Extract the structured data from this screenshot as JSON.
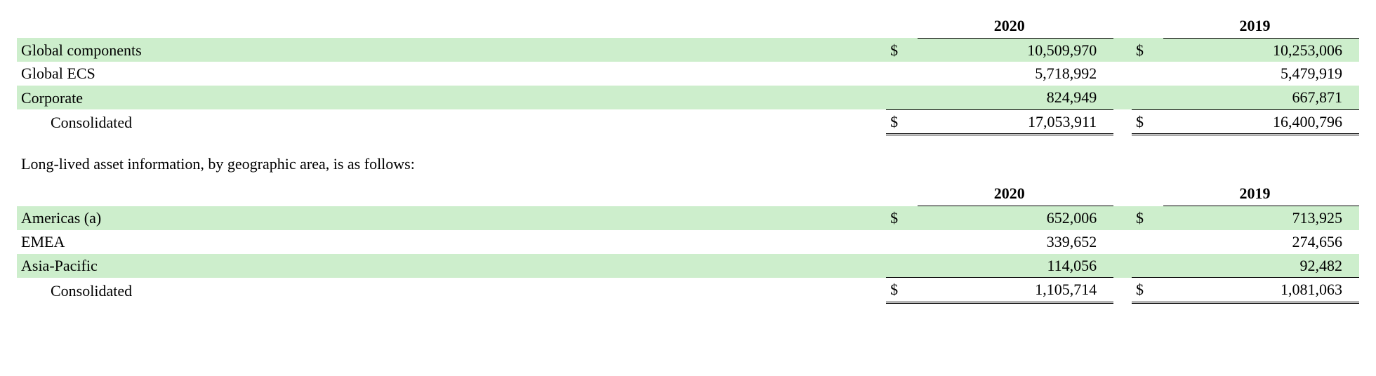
{
  "segments_table": {
    "headers": {
      "y1": "2020",
      "y2": "2019"
    },
    "rows": [
      {
        "label": "Global components",
        "sym1": "$",
        "v1": "10,509,970",
        "sym2": "$",
        "v2": "10,253,006"
      },
      {
        "label": "Global ECS",
        "sym1": "",
        "v1": "5,718,992",
        "sym2": "",
        "v2": "5,479,919"
      },
      {
        "label": "Corporate",
        "sym1": "",
        "v1": "824,949",
        "sym2": "",
        "v2": "667,871"
      }
    ],
    "total": {
      "label": "Consolidated",
      "sym1": "$",
      "v1": "17,053,911",
      "sym2": "$",
      "v2": "16,400,796"
    }
  },
  "intertext": "Long-lived asset information, by geographic area, is as follows:",
  "geo_table": {
    "headers": {
      "y1": "2020",
      "y2": "2019"
    },
    "rows": [
      {
        "label": "Americas (a)",
        "sym1": "$",
        "v1": "652,006",
        "sym2": "$",
        "v2": "713,925"
      },
      {
        "label": "EMEA",
        "sym1": "",
        "v1": "339,652",
        "sym2": "",
        "v2": "274,656"
      },
      {
        "label": "Asia-Pacific",
        "sym1": "",
        "v1": "114,056",
        "sym2": "",
        "v2": "92,482"
      }
    ],
    "total": {
      "label": "Consolidated",
      "sym1": "$",
      "v1": "1,105,714",
      "sym2": "$",
      "v2": "1,081,063"
    }
  },
  "chart_data": [
    {
      "type": "table",
      "title": "Segment information",
      "categories": [
        "2020",
        "2019"
      ],
      "series": [
        {
          "name": "Global components",
          "values": [
            10509970,
            10253006
          ]
        },
        {
          "name": "Global ECS",
          "values": [
            5718992,
            5479919
          ]
        },
        {
          "name": "Corporate",
          "values": [
            824949,
            667871
          ]
        },
        {
          "name": "Consolidated",
          "values": [
            17053911,
            16400796
          ]
        }
      ]
    },
    {
      "type": "table",
      "title": "Long-lived asset information, by geographic area",
      "categories": [
        "2020",
        "2019"
      ],
      "series": [
        {
          "name": "Americas (a)",
          "values": [
            652006,
            713925
          ]
        },
        {
          "name": "EMEA",
          "values": [
            339652,
            274656
          ]
        },
        {
          "name": "Asia-Pacific",
          "values": [
            114056,
            92482
          ]
        },
        {
          "name": "Consolidated",
          "values": [
            1105714,
            1081063
          ]
        }
      ]
    }
  ]
}
